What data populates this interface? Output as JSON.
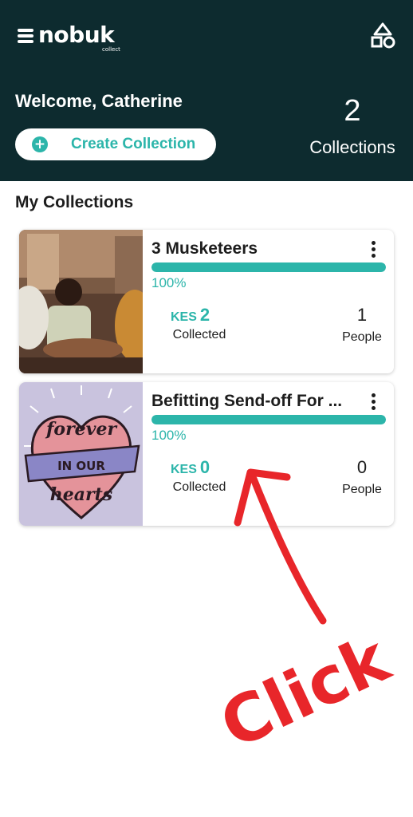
{
  "app": {
    "logo_text": "nobuk",
    "logo_sub": "collect"
  },
  "header": {
    "welcome": "Welcome, Catherine",
    "create_label": "Create Collection",
    "collections_count": "2",
    "collections_label": "Collections"
  },
  "section_title": "My Collections",
  "collections": [
    {
      "title": "3 Musketeers",
      "progress_percent": 100,
      "progress_label": "100%",
      "currency": "KES",
      "amount": "2",
      "collected_label": "Collected",
      "people": "1",
      "people_label": "People",
      "image": "group-hands-photo"
    },
    {
      "title": "Befitting Send-off For ...",
      "progress_percent": 100,
      "progress_label": "100%",
      "currency": "KES",
      "amount": "0",
      "collected_label": "Collected",
      "people": "0",
      "people_label": "People",
      "image": "forever-in-our-hearts-heart",
      "image_lettering": "forever IN OUR hearts"
    }
  ],
  "annotation": {
    "text": "Click",
    "color": "#e8262a"
  },
  "colors": {
    "header_bg": "#0d2b2f",
    "accent": "#2cb5aa"
  },
  "icons": [
    "menu-lines-icon",
    "shapes-icon",
    "plus-icon",
    "kebab-icon"
  ]
}
